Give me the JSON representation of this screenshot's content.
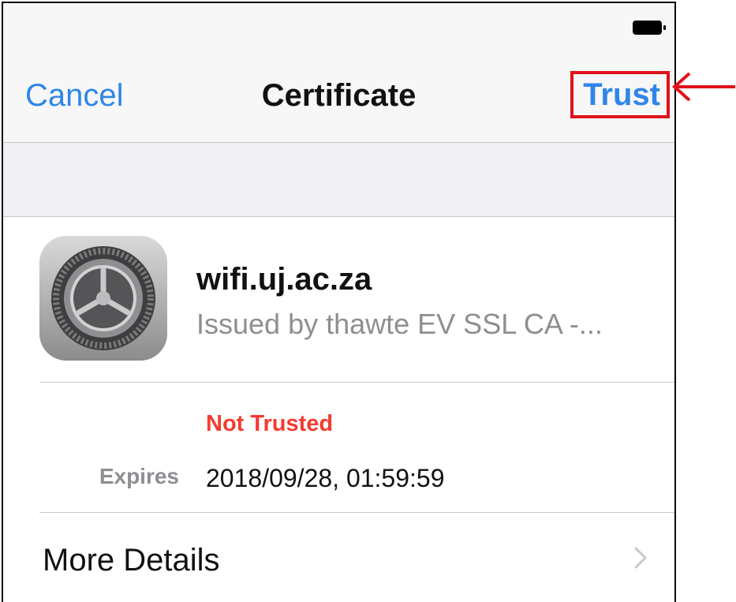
{
  "nav": {
    "cancel_label": "Cancel",
    "title": "Certificate",
    "trust_label": "Trust"
  },
  "certificate": {
    "name": "wifi.uj.ac.za",
    "issuer": "Issued by thawte EV SSL CA -...",
    "status": "Not Trusted",
    "expires_label": "Expires",
    "expires_value": "2018/09/28, 01:59:59"
  },
  "more_details_label": "More Details",
  "colors": {
    "accent": "#2f86e8",
    "status_red": "#f53b30",
    "highlight_red": "#e0121b",
    "secondary_text": "#8e8e93"
  },
  "icons": [
    "battery-icon",
    "settings-gear-icon",
    "chevron-right-icon",
    "red-arrow-icon"
  ]
}
